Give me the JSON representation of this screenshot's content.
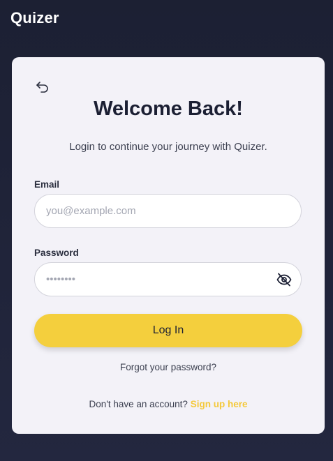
{
  "app": {
    "title": "Quizer"
  },
  "card": {
    "back_icon": "undo-arrow-icon",
    "title": "Welcome Back!",
    "subtitle": "Login to continue your journey with Quizer."
  },
  "form": {
    "email": {
      "label": "Email",
      "value": "",
      "placeholder": "you@example.com"
    },
    "password": {
      "label": "Password",
      "value": "password",
      "placeholder": "••••••••",
      "toggle_icon": "eye-off-icon"
    },
    "login_label": "Log In",
    "forgot_label": "Forgot your password?",
    "signup_prompt": "Don't have an account?",
    "signup_label": "Sign up here"
  },
  "colors": {
    "background": "#1c2033",
    "card": "#f3f2f8",
    "accent": "#f4cf3d",
    "text_dark": "#1b1f33"
  }
}
